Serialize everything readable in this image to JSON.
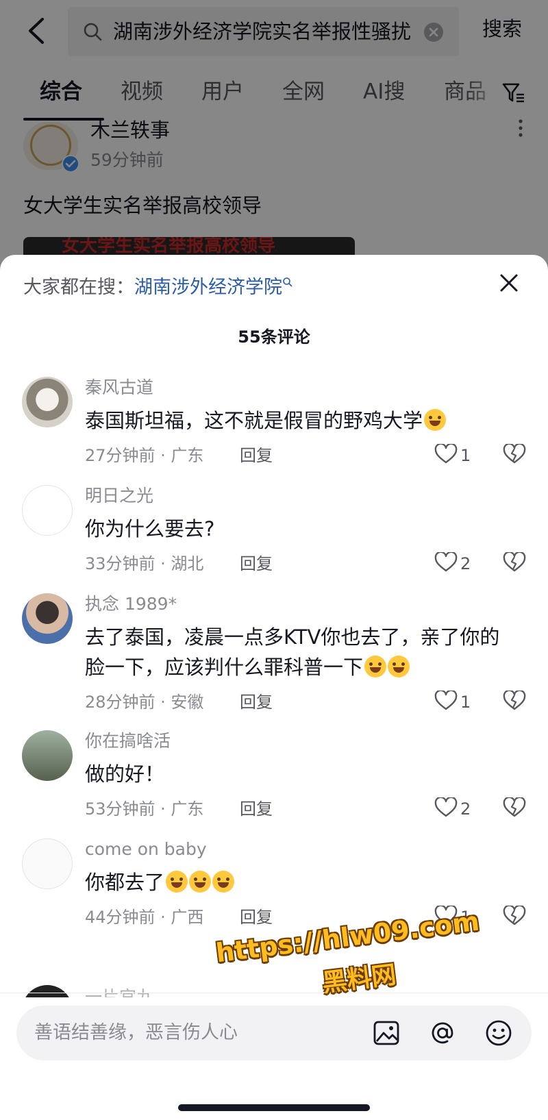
{
  "search": {
    "query": "湖南涉外经济学院实名举报性骚扰",
    "button_label": "搜索"
  },
  "tabs": [
    {
      "label": "综合",
      "active": true
    },
    {
      "label": "视频",
      "active": false
    },
    {
      "label": "用户",
      "active": false
    },
    {
      "label": "全网",
      "active": false
    },
    {
      "label": "AI搜",
      "active": false
    },
    {
      "label": "商品",
      "active": false
    }
  ],
  "post": {
    "author": "木兰轶事",
    "time": "59分钟前",
    "title": "女大学生实名举报高校领导",
    "thumbnail_text": "女大学生实名举报高校领导"
  },
  "sheet": {
    "hot_search_label": "大家都在搜：",
    "hot_search_term": "湖南涉外经济学院",
    "comment_count": "55条评论",
    "reply_label": "回复",
    "comments": [
      {
        "user": "秦风古道",
        "text": "泰国斯坦福，这不就是假冒的野鸡大学",
        "emoji_count": 1,
        "meta": "27分钟前 · 广东",
        "likes": "1"
      },
      {
        "user": "明日之光",
        "text": "你为什么要去?",
        "emoji_count": 0,
        "meta": "33分钟前 · 湖北",
        "likes": "2"
      },
      {
        "user": "执念 1989*",
        "text": "去了泰国，凌晨一点多KTV你也去了，亲了你的脸一下，应该判什么罪科普一下",
        "emoji_count": 2,
        "meta": "28分钟前 · 安徽",
        "likes": "1"
      },
      {
        "user": "你在搞啥活",
        "text": "做的好！",
        "emoji_count": 0,
        "meta": "53分钟前 · 广东",
        "likes": "2"
      },
      {
        "user": "come on baby",
        "text": "你都去了",
        "emoji_count": 3,
        "meta": "44分钟前 · 广西",
        "likes": "1"
      }
    ],
    "cut_comment_user": "一片宫九",
    "input_placeholder": "善语结善缘，恶言伤人心"
  },
  "watermark": {
    "line1": "https://hlw09.com",
    "line2": "黑料网"
  },
  "colors": {
    "link_blue": "#2a5ca8",
    "text_primary": "#161823",
    "text_secondary": "#8a8b91",
    "watermark_fill": "#ffbc1f"
  },
  "icons": [
    "back-icon",
    "search-icon",
    "clear-icon",
    "filter-icon",
    "verify-icon",
    "more-icon",
    "close-icon",
    "like-icon",
    "dislike-icon",
    "image-icon",
    "at-icon",
    "emoji-icon"
  ]
}
